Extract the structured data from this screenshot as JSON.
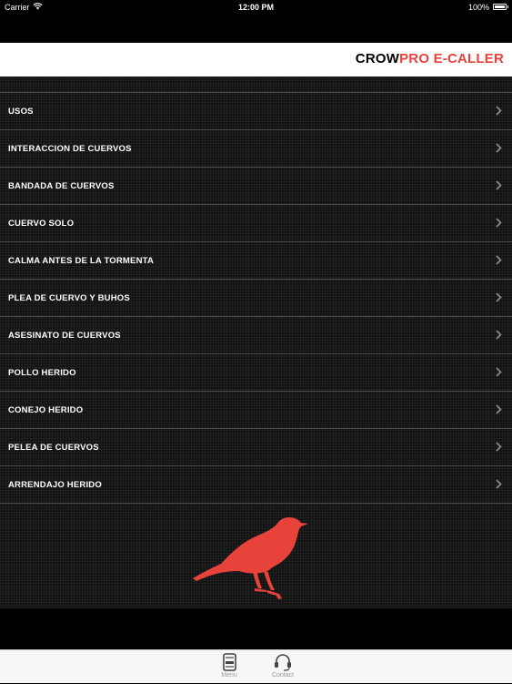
{
  "status_bar": {
    "carrier": "Carrier",
    "time": "12:00 PM",
    "battery": "100%"
  },
  "header": {
    "title_part1": "CROW",
    "title_part2": "PRO E-CALLER",
    "accent_color": "#e8433a"
  },
  "menu": {
    "items": [
      {
        "label": "USOS"
      },
      {
        "label": "INTERACCION DE CUERVOS"
      },
      {
        "label": "BANDADA DE CUERVOS"
      },
      {
        "label": "CUERVO SOLO"
      },
      {
        "label": "CALMA ANTES DE LA TORMENTA"
      },
      {
        "label": "PLEA DE CUERVO Y BUHOS"
      },
      {
        "label": "ASESINATO DE CUERVOS"
      },
      {
        "label": "POLLO HERIDO"
      },
      {
        "label": "CONEJO HERIDO"
      },
      {
        "label": "PELEA DE CUERVOS"
      },
      {
        "label": "ARRENDAJO HERIDO"
      }
    ],
    "chevron_icon": "chevron-right-icon"
  },
  "tab_bar": {
    "tabs": [
      {
        "label": "Menu",
        "icon": "menu-tab-icon"
      },
      {
        "label": "Contact",
        "icon": "headset-icon"
      }
    ]
  }
}
